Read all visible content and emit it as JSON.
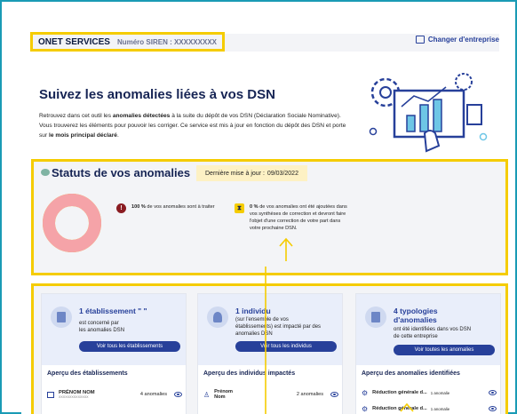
{
  "header": {
    "company_name": "ONET SERVICES",
    "siren_label": "Numéro SIREN : XXXXXXXXX",
    "change_company": "Changer d'entreprise"
  },
  "hero": {
    "title": "Suivez les anomalies liées à vos DSN",
    "desc_1": "Retrouvez dans cet outil les ",
    "desc_2": "anomalies détectées",
    "desc_3": " à la suite du dépôt de vos DSN (Déclaration Sociale Nominative). Vous trouverez les éléments pour pouvoir les corriger. Ce service est mis à jour en fonction du dépôt des DSN et porte sur ",
    "desc_4": "le mois principal déclaré",
    "desc_5": "."
  },
  "status": {
    "title": "Statuts de vos anomalies",
    "update_label": "Dernière mise à jour :",
    "update_date": "09/03/2022",
    "to_process_pct": "100 %",
    "to_process_text": " de vos anomalies sont à traiter",
    "added_pct": "0 %",
    "added_text": " de vos anomalies ont été ajoutées dans vos synthèses de correction et devront faire l'objet d'une correction de votre part dans votre prochaine DSN.",
    "donut_fraction_to_process": 1.0,
    "colors": {
      "to_process": "#f5a3a8",
      "added": "#f5cc00",
      "accent": "#27409a",
      "highlight": "#f5cc00"
    }
  },
  "cards": {
    "establishments": {
      "title": "1 établissement \"    \"",
      "line1": "est concerné par",
      "line2": "les anomalies DSN",
      "button": "Voir tous les établissements",
      "subtitle": "Aperçu des établissements",
      "row_name": "PRÉNOM NOM",
      "row_code": "XXXXXXXXXXXXXX",
      "row_count": "4 anomalies"
    },
    "individuals": {
      "title": "1 individu",
      "line1": "(sur l'ensemble de vos",
      "line2": "établissements) est impacté par des",
      "line3": "anomalies DSN",
      "button": "Voir tous les individus",
      "subtitle": "Aperçu des individus impactés",
      "row_first": "Prénom",
      "row_last": "Nom",
      "row_count": "2 anomalies"
    },
    "anomalies": {
      "title_1": "4 typologies",
      "title_2": "d'anomalies",
      "line1": "ont été identifiées dans vos DSN",
      "line2": "de cette entreprise",
      "button": "Voir toutes les anomalies",
      "subtitle": "Aperçu des anomalies identifiées",
      "row1_name": "Réduction générale d...",
      "row1_count": "1 anomalie",
      "row2_name": "Réduction générale d...",
      "row2_count": "1 anomalie"
    }
  }
}
